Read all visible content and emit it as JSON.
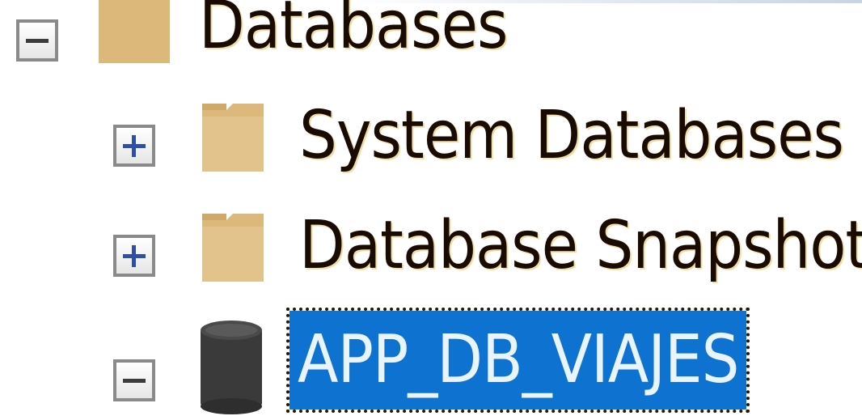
{
  "tree": {
    "root": {
      "label": "Databases",
      "expanded": true,
      "icon": "folder-icon"
    },
    "children": [
      {
        "label": "System Databases",
        "expanded": false,
        "icon": "folder-icon"
      },
      {
        "label": "Database Snapshots",
        "expanded": false,
        "icon": "folder-icon"
      },
      {
        "label": "APP_DB_VIAJES",
        "expanded": true,
        "selected": true,
        "icon": "database-icon"
      }
    ]
  },
  "colors": {
    "folder": "#dcb87a",
    "selection": "#0d72d0",
    "expander_plus": "#2f4fa5",
    "database": "#3a3a3a"
  }
}
